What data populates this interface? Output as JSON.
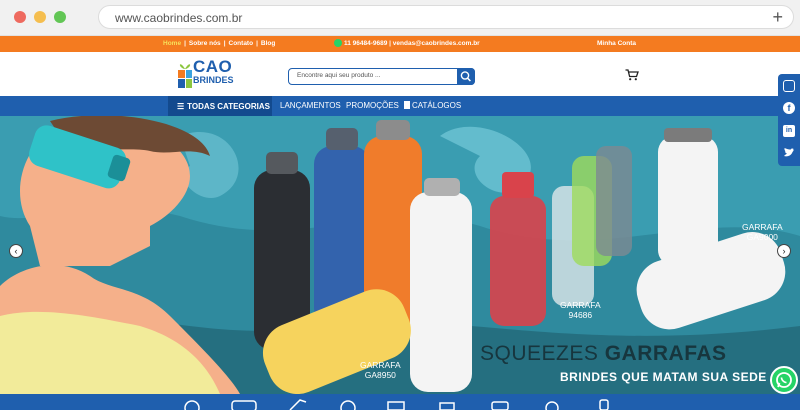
{
  "browser": {
    "url": "www.caobrindes.com.br"
  },
  "topbar": {
    "links": [
      "Home",
      "Sobre nós",
      "Contato",
      "Blog"
    ],
    "contact": "11 96484-9689 | vendas@caobrindes.com.br",
    "account": "Minha Conta"
  },
  "header": {
    "logo_line1": "CAO",
    "logo_line2": "BRINDES",
    "search_placeholder": "Encontre aqui seu produto ..."
  },
  "nav": {
    "all_categories": "TODAS CATEGORIAS",
    "items": [
      "LANÇAMENTOS",
      "PROMOÇÕES",
      "CATÁLOGOS"
    ]
  },
  "hero": {
    "headline_light": "SQUEEZES",
    "headline_bold": "GARRAFAS",
    "tagline": "BRINDES QUE MATAM SUA SEDE",
    "products": [
      {
        "line1": "GARRAFA",
        "line2": "GA9000"
      },
      {
        "line1": "GARRAFA",
        "line2": "94686"
      },
      {
        "line1": "GARRAFA",
        "line2": "GA8950"
      }
    ],
    "prev": "‹",
    "next": "›"
  },
  "colors": {
    "orange": "#f47b20",
    "blue": "#1f5fae",
    "hero_bg": "#2f8a9e",
    "whatsapp": "#25d366"
  }
}
